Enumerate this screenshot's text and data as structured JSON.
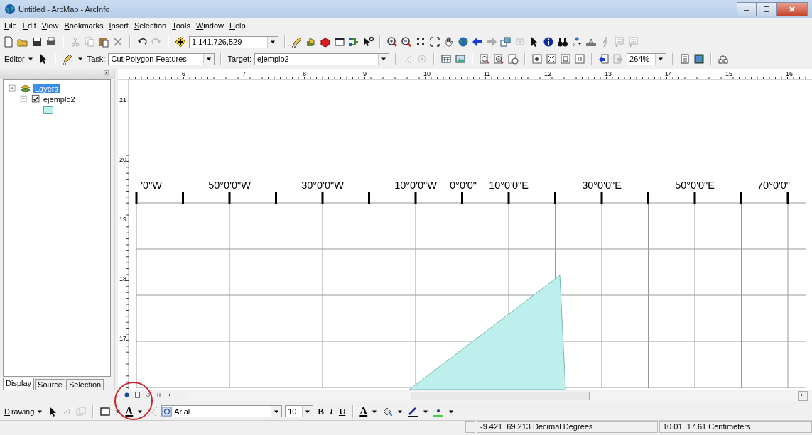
{
  "window": {
    "title": "Untitled - ArcMap - ArcInfo"
  },
  "menu": [
    "File",
    "Edit",
    "View",
    "Bookmarks",
    "Insert",
    "Selection",
    "Tools",
    "Window",
    "Help"
  ],
  "standard_toolbar": {
    "scale": "1:141,726,529"
  },
  "editor_toolbar": {
    "editor": "Editor",
    "task_label": "Task:",
    "task": "Cut Polygon Features",
    "target_label": "Target:",
    "target": "ejemplo2"
  },
  "layout_toolbar": {
    "zoom": "264%"
  },
  "toc": {
    "layers": {
      "label": "Layers",
      "selected": true,
      "expanded": true,
      "children": [
        {
          "label": "ejemplo2",
          "checked": true,
          "expanded": true
        }
      ]
    },
    "tabs": [
      {
        "label": "Display",
        "selected": true
      },
      {
        "label": "Source",
        "selected": false
      },
      {
        "label": "Selection",
        "selected": false
      }
    ]
  },
  "map": {
    "top_ruler": [
      "6",
      "7",
      "8",
      "9",
      "10",
      "11",
      "12",
      "13",
      "14",
      "15",
      "16"
    ],
    "left_ruler": [
      "21",
      "20",
      "19",
      "18",
      "17"
    ],
    "graticule_labels": [
      "'0\"W",
      "50°0'0\"W",
      "30°0'0\"W",
      "10°0'0\"W",
      "0°0'0\"",
      "10°0'0\"E",
      "30°0'0\"E",
      "50°0'0\"E",
      "70°0'0\""
    ]
  },
  "drawing_toolbar": {
    "drawing": "Drawing",
    "text_tool": "A",
    "font": "Arial",
    "size": "10",
    "bold": "B",
    "italic": "I",
    "underline": "U",
    "font_color": "A"
  },
  "status_bar": {
    "coordinates": "-9.421  69.213 Decimal Degrees",
    "page_position": "10.01  17.61 Centimeters"
  }
}
